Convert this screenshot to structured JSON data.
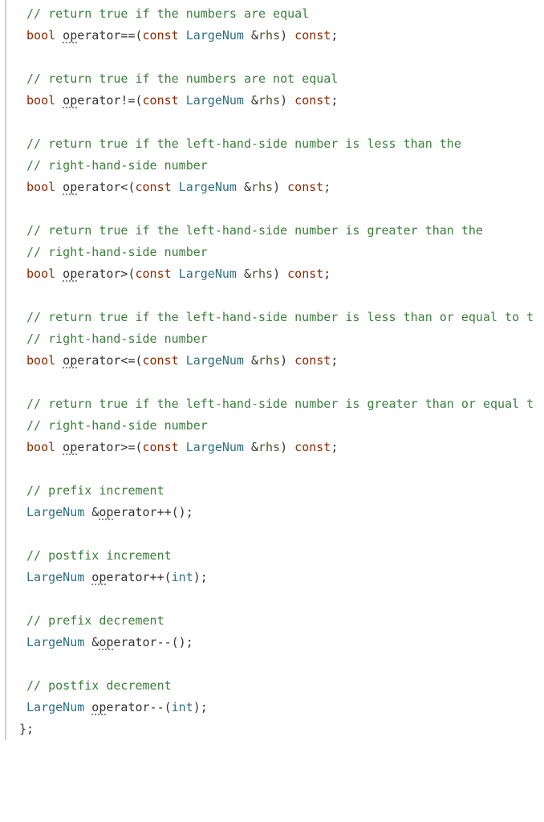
{
  "code": {
    "blocks": [
      {
        "comments": [
          "// return true if the numbers are equal"
        ],
        "decl": {
          "ret": "bool",
          "pre": "",
          "sqStart": 0,
          "sqLen": 2,
          "nameRest": "erator==",
          "args": "const LargeNum &rhs",
          "post": " const"
        }
      },
      {
        "comments": [
          "// return true if the numbers are not equal"
        ],
        "decl": {
          "ret": "bool",
          "pre": "",
          "sqStart": 0,
          "sqLen": 2,
          "nameRest": "erator!=",
          "args": "const LargeNum &rhs",
          "post": " const"
        }
      },
      {
        "comments": [
          "// return true if the left-hand-side number is less than the",
          "// right-hand-side number"
        ],
        "decl": {
          "ret": "bool",
          "pre": "",
          "sqStart": 0,
          "sqLen": 2,
          "nameRest": "erator<",
          "args": "const LargeNum &rhs",
          "post": " const"
        }
      },
      {
        "comments": [
          "// return true if the left-hand-side number is greater than the",
          "// right-hand-side number"
        ],
        "decl": {
          "ret": "bool",
          "pre": "",
          "sqStart": 0,
          "sqLen": 2,
          "nameRest": "erator>",
          "args": "const LargeNum &rhs",
          "post": " const"
        }
      },
      {
        "comments": [
          "// return true if the left-hand-side number is less than or equal to t",
          "// right-hand-side number"
        ],
        "decl": {
          "ret": "bool",
          "pre": "",
          "sqStart": 0,
          "sqLen": 2,
          "nameRest": "erator<=",
          "args": "const LargeNum &rhs",
          "post": " const"
        }
      },
      {
        "comments": [
          "// return true if the left-hand-side number is greater than or equal t",
          "// right-hand-side number"
        ],
        "decl": {
          "ret": "bool",
          "pre": "",
          "sqStart": 0,
          "sqLen": 2,
          "nameRest": "erator>=",
          "args": "const LargeNum &rhs",
          "post": " const"
        }
      },
      {
        "comments": [
          "// prefix increment"
        ],
        "decl": {
          "ret": "LargeNum",
          "pre": "&",
          "sqStart": 0,
          "sqLen": 2,
          "nameRest": "erator++",
          "args": "",
          "post": ""
        }
      },
      {
        "comments": [
          "// postfix increment"
        ],
        "decl": {
          "ret": "LargeNum",
          "pre": "",
          "sqStart": 0,
          "sqLen": 2,
          "nameRest": "erator++",
          "args": "int",
          "post": ""
        }
      },
      {
        "comments": [
          "// prefix decrement"
        ],
        "decl": {
          "ret": "LargeNum",
          "pre": "&",
          "sqStart": 0,
          "sqLen": 2,
          "nameRest": "erator--",
          "args": "",
          "post": ""
        }
      },
      {
        "comments": [
          "// postfix decrement"
        ],
        "decl": {
          "ret": "LargeNum",
          "pre": "",
          "sqStart": 0,
          "sqLen": 2,
          "nameRest": "erator--",
          "args": "int",
          "post": ""
        }
      }
    ],
    "closing": "};",
    "fullOperatorName": "operator",
    "argTokens": {
      "const": "const",
      "type": "LargeNum",
      "amp": "&",
      "param": "rhs",
      "int": "int"
    }
  },
  "colors": {
    "comment": "#3b7f3b",
    "keyword": "#8c2a00",
    "type": "#2f6f81",
    "param": "#4a5a2a",
    "punct": "#333333"
  }
}
